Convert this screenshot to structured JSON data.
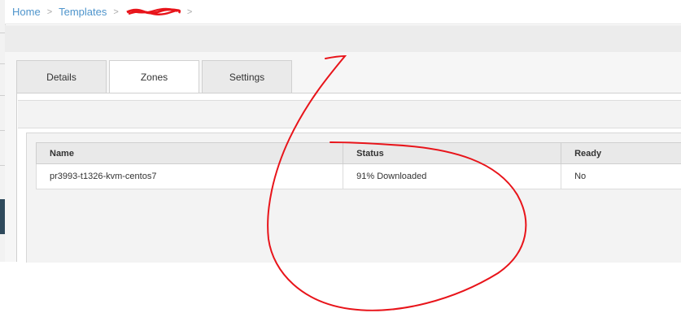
{
  "breadcrumb": {
    "items": [
      "Home",
      "Templates"
    ],
    "current": "template"
  },
  "tabs": [
    {
      "label": "Details",
      "active": false
    },
    {
      "label": "Zones",
      "active": true
    },
    {
      "label": "Settings",
      "active": false
    }
  ],
  "zones_table": {
    "headers": [
      "Name",
      "Status",
      "Ready"
    ],
    "rows": [
      {
        "name": "pr3993-t1326-kvm-centos7",
        "status": "91% Downloaded",
        "ready": "No"
      }
    ]
  },
  "annotation": {
    "color": "#e8141a",
    "label": "6"
  },
  "colors": {
    "link": "#4f95cc",
    "tab_bg": "#eaeaea",
    "header_bg": "#e9e9e9"
  }
}
